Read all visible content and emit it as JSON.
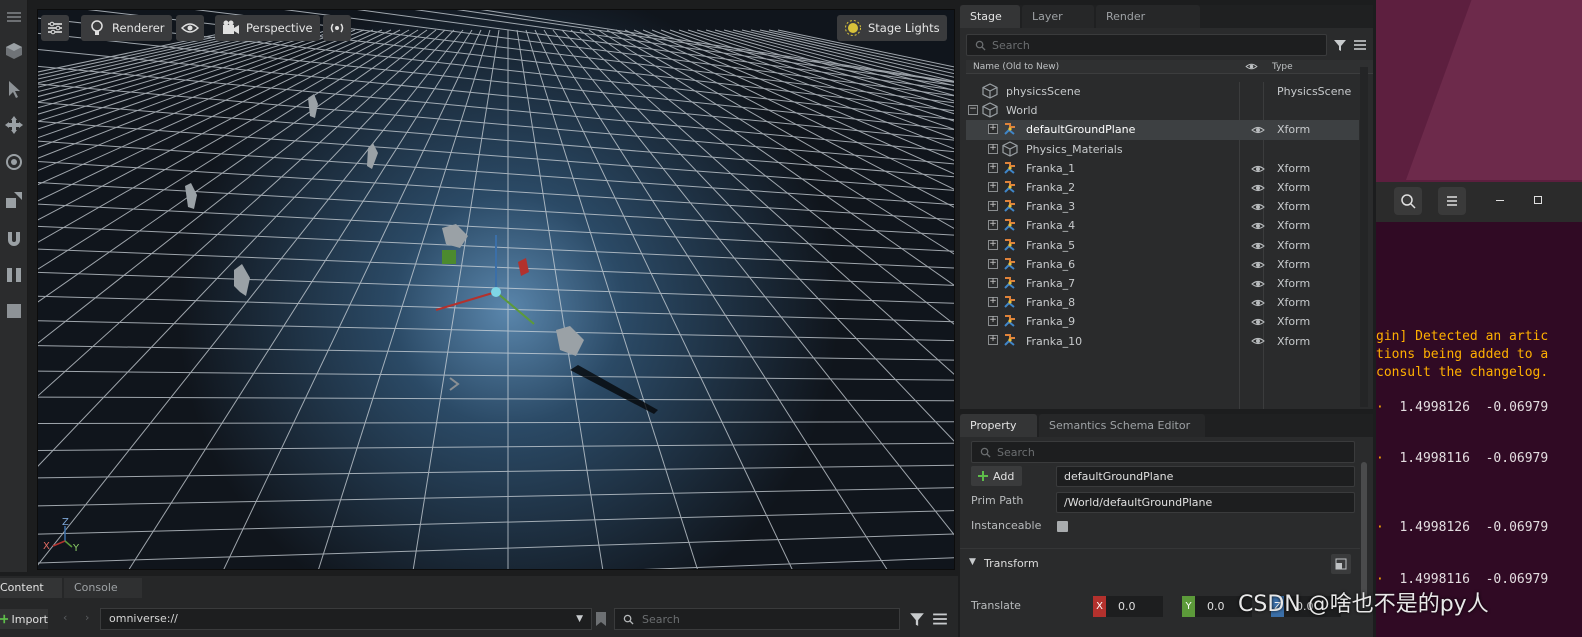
{
  "viewport": {
    "renderer_label": "Renderer",
    "camera_label": "Perspective",
    "lights_label": "Stage Lights",
    "axis_x": "X",
    "axis_y": "Y",
    "axis_z": "Z"
  },
  "stage": {
    "tabs": [
      "Stage",
      "Layer",
      "Render Settings"
    ],
    "search_placeholder": "Search",
    "col_name": "Name (Old to New)",
    "col_type": "Type",
    "rows": [
      {
        "name": "physicsScene",
        "type": "PhysicsScene",
        "depth": 0,
        "expander": "",
        "icon": "cube-icon",
        "eye": false
      },
      {
        "name": "World",
        "type": "",
        "depth": 0,
        "expander": "−",
        "icon": "cube-icon",
        "eye": false
      },
      {
        "name": "defaultGroundPlane",
        "type": "Xform",
        "depth": 1,
        "expander": "+",
        "icon": "xform-icon",
        "eye": true,
        "selected": true
      },
      {
        "name": "Physics_Materials",
        "type": "",
        "depth": 1,
        "expander": "+",
        "icon": "cube-icon",
        "eye": false
      },
      {
        "name": "Franka_1",
        "type": "Xform",
        "depth": 1,
        "expander": "+",
        "icon": "xform-icon",
        "eye": true
      },
      {
        "name": "Franka_2",
        "type": "Xform",
        "depth": 1,
        "expander": "+",
        "icon": "xform-icon",
        "eye": true
      },
      {
        "name": "Franka_3",
        "type": "Xform",
        "depth": 1,
        "expander": "+",
        "icon": "xform-icon",
        "eye": true
      },
      {
        "name": "Franka_4",
        "type": "Xform",
        "depth": 1,
        "expander": "+",
        "icon": "xform-icon",
        "eye": true
      },
      {
        "name": "Franka_5",
        "type": "Xform",
        "depth": 1,
        "expander": "+",
        "icon": "xform-icon",
        "eye": true
      },
      {
        "name": "Franka_6",
        "type": "Xform",
        "depth": 1,
        "expander": "+",
        "icon": "xform-icon",
        "eye": true
      },
      {
        "name": "Franka_7",
        "type": "Xform",
        "depth": 1,
        "expander": "+",
        "icon": "xform-icon",
        "eye": true
      },
      {
        "name": "Franka_8",
        "type": "Xform",
        "depth": 1,
        "expander": "+",
        "icon": "xform-icon",
        "eye": true
      },
      {
        "name": "Franka_9",
        "type": "Xform",
        "depth": 1,
        "expander": "+",
        "icon": "xform-icon",
        "eye": true
      },
      {
        "name": "Franka_10",
        "type": "Xform",
        "depth": 1,
        "expander": "+",
        "icon": "xform-icon",
        "eye": true
      }
    ]
  },
  "property": {
    "tabs": [
      "Property",
      "Semantics Schema Editor"
    ],
    "search_placeholder": "Search",
    "add_label": "Add",
    "prim_name": "defaultGroundPlane",
    "prim_path_label": "Prim Path",
    "prim_path": "/World/defaultGroundPlane",
    "instanceable_label": "Instanceable",
    "transform_label": "Transform",
    "translate_label": "Translate",
    "x_label": "X",
    "x_value": "0.0",
    "y_label": "Y",
    "y_value": "0.0",
    "z_label": "Z",
    "z_value": "0.0"
  },
  "console": {
    "line1": "gin] Detected an artic",
    "line2": "tions being added to a",
    "line3": "consult the changelog.",
    "values": [
      {
        "a": "1.4998126",
        "b": "-0.06979"
      },
      {
        "a": "1.4998116",
        "b": "-0.06979"
      },
      {
        "a": "1.4998126",
        "b": "-0.06979"
      },
      {
        "a": "1.4998116",
        "b": "-0.06979"
      }
    ]
  },
  "bottom": {
    "tab_content": "Content",
    "tab_console": "Console",
    "import_label": "Import",
    "path_value": "omniverse://",
    "search_placeholder": "Search"
  },
  "watermark": "CSDN @啥也不是的py人",
  "colors": {
    "accent_x": "#b3312d",
    "accent_y": "#5c9a3a",
    "accent_z": "#3b6fa8",
    "terminal_bg": "#300a24",
    "terminal_text": "#ffb000"
  }
}
